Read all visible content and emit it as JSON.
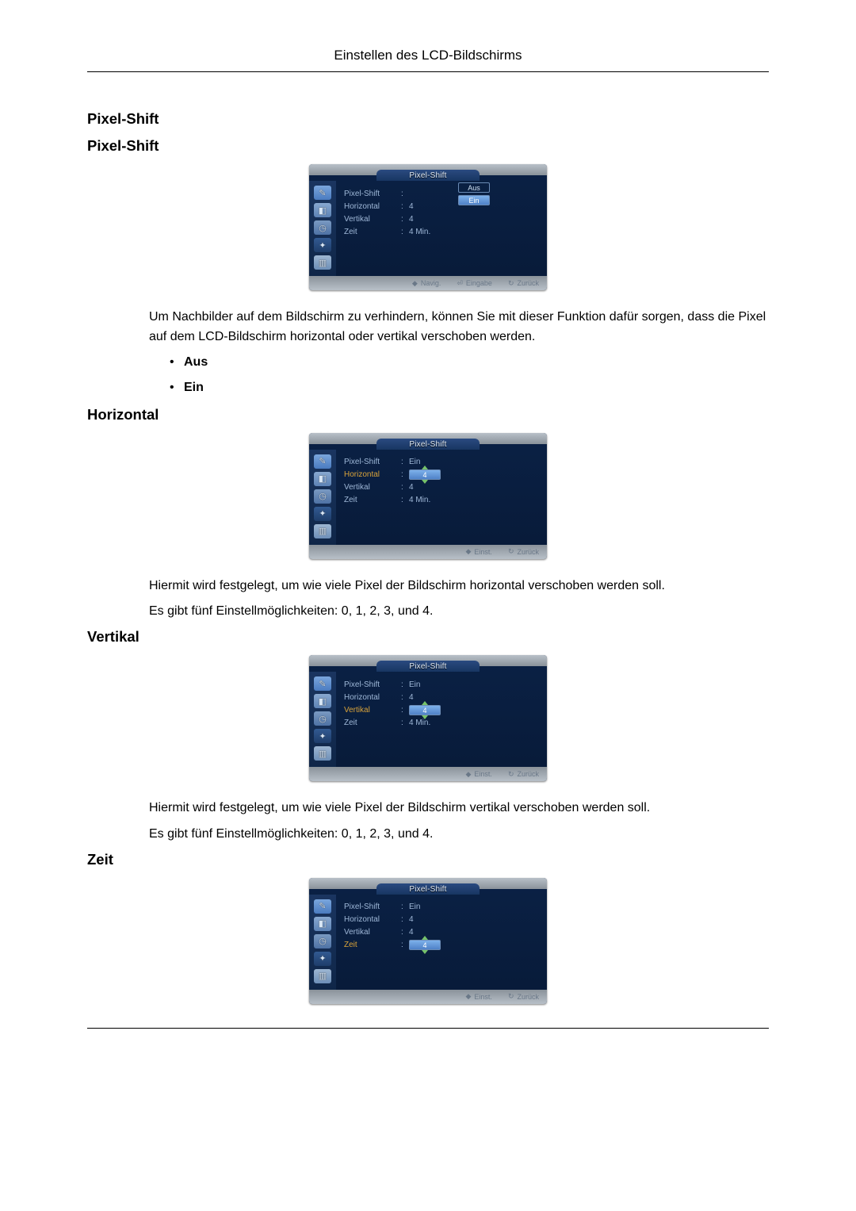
{
  "header": {
    "title": "Einstellen des LCD-Bildschirms"
  },
  "osd_common": {
    "title": "Pixel-Shift",
    "labels": {
      "pixel_shift": "Pixel-Shift",
      "horizontal": "Horizontal",
      "vertikal": "Vertikal",
      "zeit": "Zeit"
    },
    "footer": {
      "navig": "Navig.",
      "eingabe": "Eingabe",
      "zurueck": "Zurück",
      "einst": "Einst."
    }
  },
  "sections": {
    "s1_title": "Pixel-Shift",
    "s1_sub": "Pixel-Shift",
    "s1_desc": "Um Nachbilder auf dem Bildschirm zu verhindern, können Sie mit dieser Funktion dafür sorgen, dass die Pixel auf dem LCD-Bildschirm horizontal oder vertikal verschoben werden.",
    "s1_opts": {
      "aus": "Aus",
      "ein": "Ein"
    },
    "s2_title": "Horizontal",
    "s2_desc1": "Hiermit wird festgelegt, um wie viele Pixel der Bildschirm horizontal verschoben werden soll.",
    "s2_desc2": "Es gibt fünf Einstellmöglichkeiten: 0, 1, 2, 3, und 4.",
    "s3_title": "Vertikal",
    "s3_desc1": "Hiermit wird festgelegt, um wie viele Pixel der Bildschirm vertikal verschoben werden soll.",
    "s3_desc2": "Es gibt fünf Einstellmöglichkeiten: 0, 1, 2, 3, und 4.",
    "s4_title": "Zeit"
  },
  "osd1": {
    "pixel_shift_opts": {
      "aus": "Aus",
      "ein": "Ein"
    },
    "horizontal": "4",
    "vertikal": "4",
    "zeit": "4 Min."
  },
  "osd2": {
    "pixel_shift": "Ein",
    "horizontal_box": "4",
    "vertikal": "4",
    "zeit": "4 Min."
  },
  "osd3": {
    "pixel_shift": "Ein",
    "horizontal": "4",
    "vertikal_box": "4",
    "zeit": "4 Min."
  },
  "osd4": {
    "pixel_shift": "Ein",
    "horizontal": "4",
    "vertikal": "4",
    "zeit_box": "4"
  }
}
